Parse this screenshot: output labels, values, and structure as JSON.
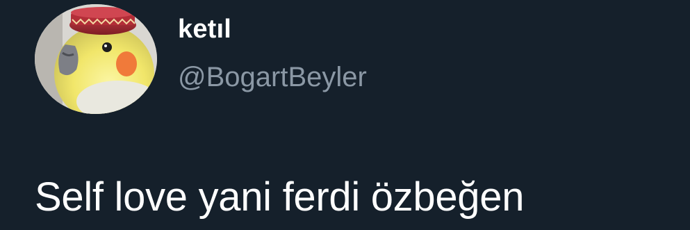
{
  "tweet": {
    "author": {
      "display_name": "ketıl",
      "handle": "@BogartBeyler",
      "avatar_icon": "cockatiel-avatar-icon"
    },
    "text": "Self love yani ferdi özbeğen"
  },
  "colors": {
    "background": "#15202b",
    "primary_text": "#ffffff",
    "secondary_text": "#8b98a5"
  }
}
